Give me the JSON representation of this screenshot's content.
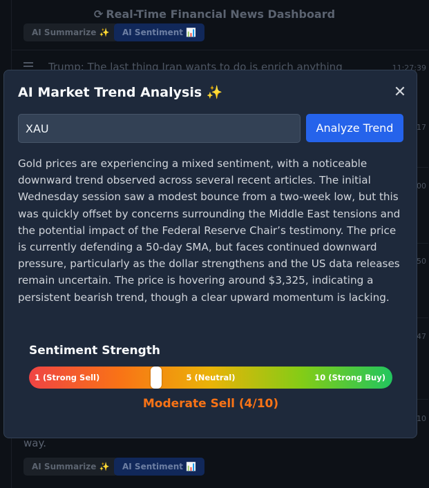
{
  "background": {
    "header_icon": "refresh-icon",
    "header_title": "Real-Time Financial News Dashboard",
    "summarize_label": "AI Summarize ✨",
    "sentiment_label": "AI Sentiment 📊",
    "headline": "Trump: The last thing Iran wants to do is enrich anything",
    "times": [
      "11:27:39",
      "17",
      "00",
      "50",
      "47",
      "10"
    ],
    "tail_text": "way."
  },
  "modal": {
    "title": "AI Market Trend Analysis ✨",
    "close_label": "✕",
    "ticker_value": "XAU",
    "analyze_label": "Analyze Trend",
    "analysis": "Gold prices are experiencing a mixed sentiment, with a noticeable downward trend observed across several recent articles. The initial Wednesday session saw a modest bounce from a two-week low, but this was quickly offset by concerns surrounding the Middle East tensions and the potential impact of the Federal Reserve Chair’s testimony. The price is currently defending a 50-day SMA, but faces continued downward pressure, particularly as the dollar strengthens and the US data releases remain uncertain. The price is hovering around $3,325, indicating a persistent bearish trend, though a clear upward momentum is lacking.",
    "sentiment": {
      "title": "Sentiment Strength",
      "min_label": "1 (Strong Sell)",
      "mid_label": "5 (Neutral)",
      "max_label": "10 (Strong Buy)",
      "score": 4,
      "scale_min": 1,
      "scale_max": 10,
      "verdict": "Moderate Sell (4/10)",
      "verdict_color": "#f97316"
    }
  }
}
